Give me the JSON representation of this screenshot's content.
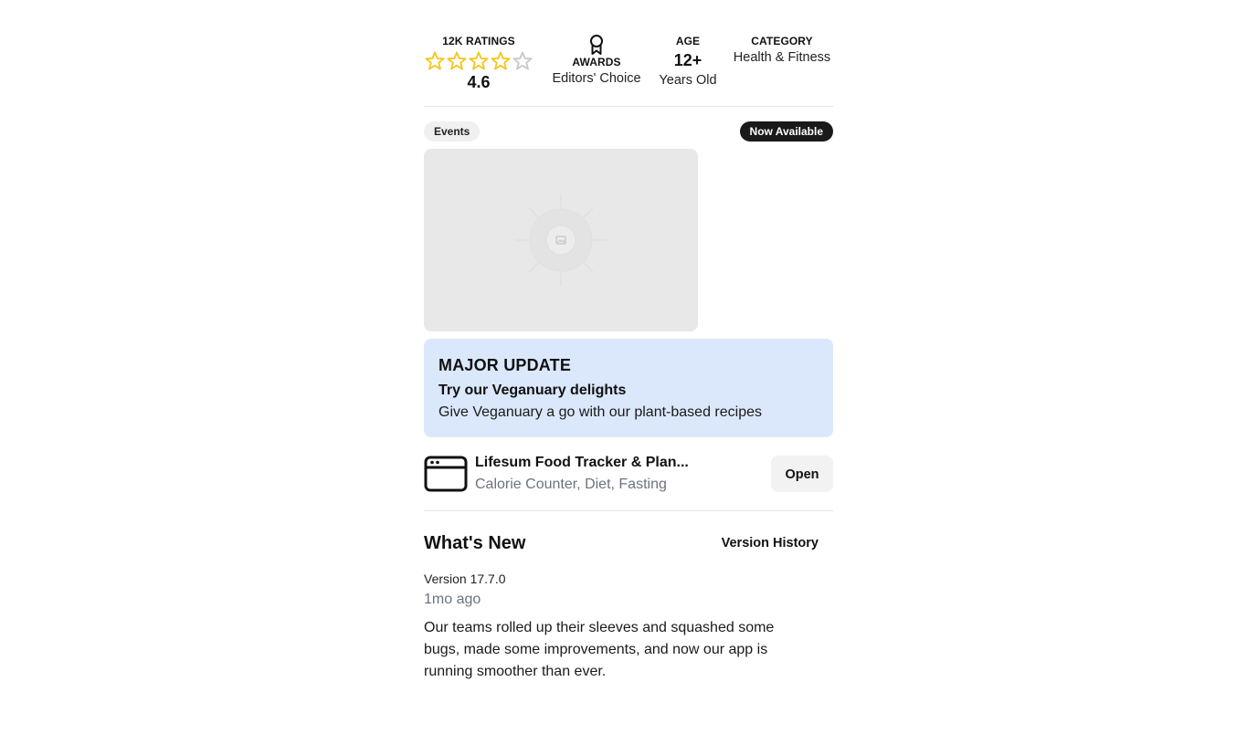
{
  "stats": {
    "ratings": {
      "label": "12K RATINGS",
      "value": "4.6",
      "stars_filled": 4,
      "stars_total": 5
    },
    "awards": {
      "label": "AWARDS",
      "value": "Editors' Choice"
    },
    "age": {
      "label": "AGE",
      "value": "12+",
      "sub": "Years Old"
    },
    "category": {
      "label": "CATEGORY",
      "value": "Health & Fitness"
    }
  },
  "events": {
    "tag": "Events",
    "badge": "Now Available",
    "image_icon": "image-placeholder-icon",
    "card": {
      "badge": "MAJOR UPDATE",
      "title": "Try our Veganuary delights",
      "description": "Give Veganuary a go with our plant-based recipes"
    }
  },
  "app": {
    "icon": "app-window-icon",
    "name": "Lifesum Food Tracker & Plan...",
    "subtitle": "Calorie Counter, Diet, Fasting",
    "open_label": "Open"
  },
  "whats_new": {
    "title": "What's New",
    "version_history_label": "Version History",
    "version": "Version 17.7.0",
    "date": "1mo ago",
    "notes": "Our teams rolled up their sleeves and squashed some bugs, made some improvements, and now our app is running smoother than ever."
  },
  "colors": {
    "star": "#f5c518",
    "star_empty": "#c8c8c8",
    "card_bg": "#dbe8fc",
    "badge_bg": "#1a1a1a"
  }
}
